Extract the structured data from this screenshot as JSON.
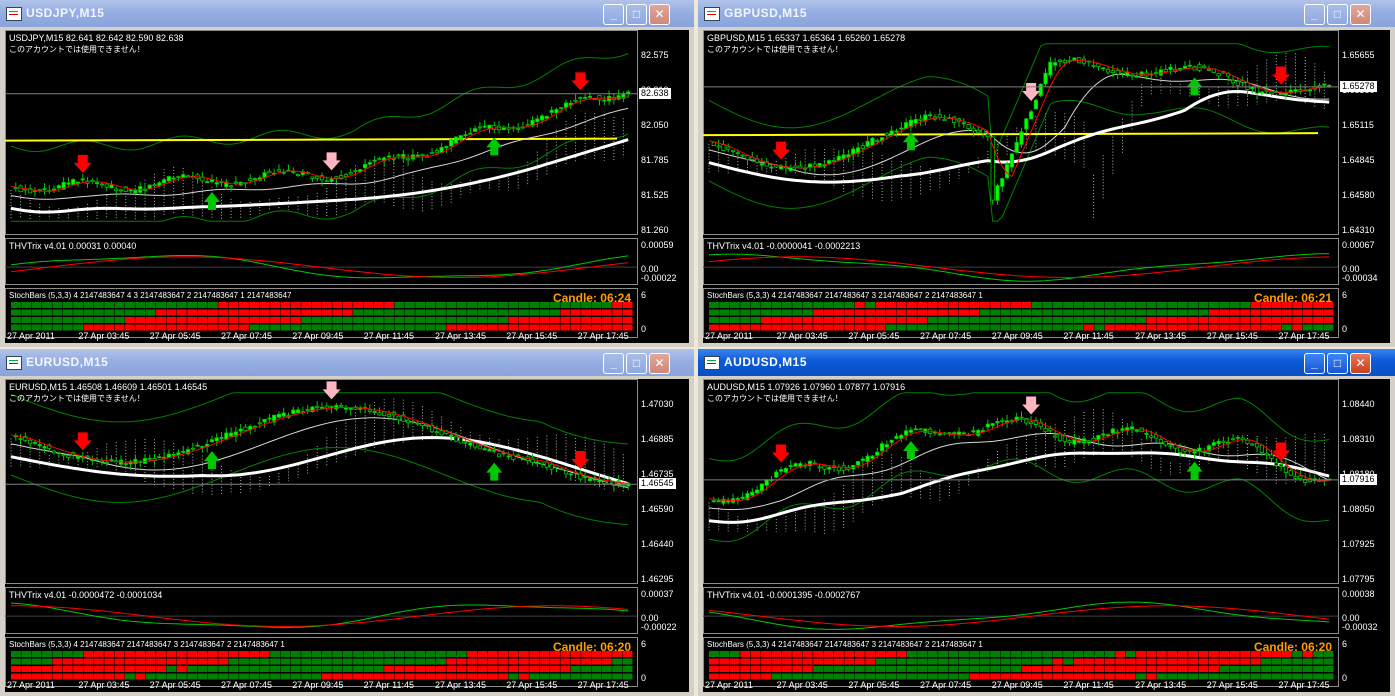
{
  "windows": [
    {
      "id": "usdjpy",
      "active": false,
      "title": "USDJPY,M15",
      "info": "USDJPY,M15  82.641 82.642 82.590 82.638",
      "notice": "このアカウントでは使用できません！",
      "price_levels": [
        "82.575",
        "82.310",
        "82.050",
        "81.785",
        "81.525",
        "81.260"
      ],
      "current_price": "82.638",
      "indicator_label": "THVTrix v4.01 0.00031 0.00040",
      "indicator_levels": [
        "0.00059",
        "0.00",
        "-0.00022"
      ],
      "stoch_label": "StochBars (5,3,3) 4 2147483647 4 3 2147483647 2 2147483647 1 2147483647",
      "stoch_levels": [
        "6",
        "0"
      ],
      "candle_label": "Candle:  06:24",
      "time_labels": [
        "27 Apr 2011",
        "27 Apr 03:45",
        "27 Apr 05:45",
        "27 Apr 07:45",
        "27 Apr 09:45",
        "27 Apr 11:45",
        "27 Apr 13:45",
        "27 Apr 15:45",
        "27 Apr 17:45"
      ]
    },
    {
      "id": "gbpusd",
      "active": false,
      "title": "GBPUSD,M15",
      "info": "GBPUSD,M15  1.65337 1.65364 1.65260 1.65278",
      "notice": "このアカウントでは使用できません！",
      "price_levels": [
        "1.65655",
        "1.65380",
        "1.65115",
        "1.64845",
        "1.64580",
        "1.64310"
      ],
      "current_price": "1.65278",
      "indicator_label": "THVTrix v4.01 -0.0000041 -0.0002213",
      "indicator_levels": [
        "0.00067",
        "0.00",
        "-0.00034"
      ],
      "stoch_label": "StochBars (5,3,3) 4 2147483647 2147483647 3 2147483647 2 2147483647 1",
      "stoch_levels": [
        "6",
        "0"
      ],
      "candle_label": "Candle:  06:21",
      "time_labels": [
        "27 Apr 2011",
        "27 Apr 03:45",
        "27 Apr 05:45",
        "27 Apr 07:45",
        "27 Apr 09:45",
        "27 Apr 11:45",
        "27 Apr 13:45",
        "27 Apr 15:45",
        "27 Apr 17:45"
      ]
    },
    {
      "id": "eurusd",
      "active": false,
      "title": "EURUSD,M15",
      "info": "EURUSD,M15  1.46508 1.46609 1.46501 1.46545",
      "notice": "このアカウントでは使用できません！",
      "price_levels": [
        "1.47030",
        "1.46885",
        "1.46735",
        "1.46590",
        "1.46440",
        "1.46295"
      ],
      "current_price": "1.46545",
      "indicator_label": "THVTrix v4.01 -0.0000472 -0.0001034",
      "indicator_levels": [
        "0.00037",
        "0.00",
        "-0.00022"
      ],
      "stoch_label": "StochBars (5,3,3) 4 2147483647 2147483647 3 2147483647 2 2147483647 1",
      "stoch_levels": [
        "6",
        "0"
      ],
      "candle_label": "Candle:  06:20",
      "time_labels": [
        "27 Apr 2011",
        "27 Apr 03:45",
        "27 Apr 05:45",
        "27 Apr 07:45",
        "27 Apr 09:45",
        "27 Apr 11:45",
        "27 Apr 13:45",
        "27 Apr 15:45",
        "27 Apr 17:45"
      ]
    },
    {
      "id": "audusd",
      "active": true,
      "title": "AUDUSD,M15",
      "info": "AUDUSD,M15  1.07926 1.07960 1.07877 1.07916",
      "notice": "このアカウントでは使用できません！",
      "price_levels": [
        "1.08440",
        "1.08310",
        "1.08180",
        "1.08050",
        "1.07925",
        "1.07795"
      ],
      "current_price": "1.07916",
      "indicator_label": "THVTrix v4.01 -0.0001395 -0.0002767",
      "indicator_levels": [
        "0.00038",
        "0.00",
        "-0.00032"
      ],
      "stoch_label": "StochBars (5,3,3) 4 2147483647 2147483647 3 2147483647 2 2147483647 1",
      "stoch_levels": [
        "6",
        "0"
      ],
      "candle_label": "Candle:  06:20",
      "time_labels": [
        "27 Apr 2011",
        "27 Apr 03:45",
        "27 Apr 05:45",
        "27 Apr 07:45",
        "27 Apr 09:45",
        "27 Apr 11:45",
        "27 Apr 13:45",
        "27 Apr 15:45",
        "27 Apr 17:45"
      ]
    }
  ],
  "window_buttons": {
    "minimize": "_",
    "maximize": "□",
    "close": "✕"
  },
  "icons": {
    "app": "chart-window-icon",
    "minimize": "minimize-icon",
    "maximize": "maximize-icon",
    "close": "close-icon"
  },
  "colors": {
    "bull_candle": "#00ff00",
    "bear_candle": "#000000",
    "candle_outline": "#00c800",
    "ma_fast": "#ff0000",
    "ma_slow": "#ffffff",
    "ma_yellow": "#ffff00",
    "envelope": "#008000",
    "trix_main": "#00c800",
    "trix_signal": "#ff0000",
    "stoch_up": "#008000",
    "stoch_down": "#ff0000",
    "candle_timer": "#ff9c00",
    "buy_arrow": "#00c800",
    "sell_arrow": "#ff0000"
  }
}
